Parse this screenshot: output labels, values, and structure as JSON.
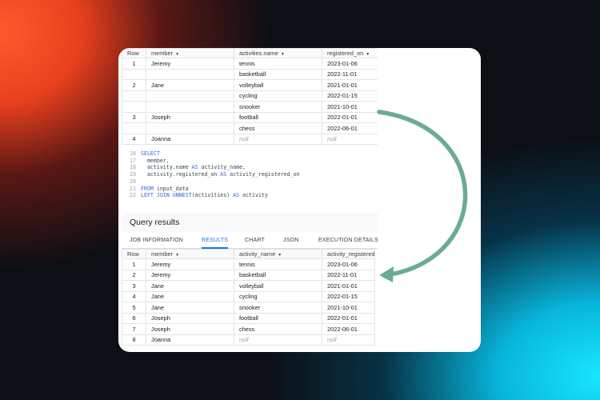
{
  "input_table": {
    "columns": [
      "Row",
      "member",
      "activities.name",
      "registered_on"
    ],
    "rows": [
      {
        "row": "1",
        "member": "Jeremy",
        "activities": [
          {
            "name": "tennis",
            "registered_on": "2023-01-06"
          },
          {
            "name": "basketball",
            "registered_on": "2022-11-01"
          }
        ]
      },
      {
        "row": "2",
        "member": "Jane",
        "activities": [
          {
            "name": "volleyball",
            "registered_on": "2021-01-01"
          },
          {
            "name": "cycling",
            "registered_on": "2022-01-15"
          },
          {
            "name": "snooker",
            "registered_on": "2021-10-01"
          }
        ]
      },
      {
        "row": "3",
        "member": "Joseph",
        "activities": [
          {
            "name": "football",
            "registered_on": "2022-01-01"
          },
          {
            "name": "chess",
            "registered_on": "2022-06-01"
          }
        ]
      },
      {
        "row": "4",
        "member": "Joanna",
        "activities": [
          {
            "name": "null",
            "registered_on": "null"
          }
        ]
      }
    ]
  },
  "sql": {
    "lines": [
      {
        "num": "16",
        "text": "SELECT"
      },
      {
        "num": "17",
        "text": "  member,"
      },
      {
        "num": "18",
        "text": "  activity.name AS activity_name,"
      },
      {
        "num": "19",
        "text": "  activity.registered_on AS activity_registered_on"
      },
      {
        "num": "20",
        "text": ""
      },
      {
        "num": "21",
        "text": "FROM input_data"
      },
      {
        "num": "22",
        "text": "LEFT JOIN UNNEST(activities) AS activity"
      }
    ]
  },
  "results": {
    "title": "Query results",
    "tabs": [
      "JOB INFORMATION",
      "RESULTS",
      "CHART",
      "JSON",
      "EXECUTION DETAILS"
    ],
    "active_tab": "RESULTS",
    "columns": [
      "Row",
      "member",
      "activity_name",
      "activity_registered_o"
    ],
    "rows": [
      [
        "1",
        "Jeremy",
        "tennis",
        "2023-01-06"
      ],
      [
        "2",
        "Jeremy",
        "basketball",
        "2022-11-01"
      ],
      [
        "3",
        "Jane",
        "volleyball",
        "2021-01-01"
      ],
      [
        "4",
        "Jane",
        "cycling",
        "2022-01-15"
      ],
      [
        "5",
        "Jane",
        "snooker",
        "2021-10-01"
      ],
      [
        "6",
        "Joseph",
        "football",
        "2022-01-01"
      ],
      [
        "7",
        "Joseph",
        "chess",
        "2022-06-01"
      ],
      [
        "8",
        "Joanna",
        "null",
        "null"
      ]
    ]
  },
  "colors": {
    "arrow": "#6aab97",
    "accent": "#1a73e8",
    "keyword": "#3367d6",
    "null_text": "#9aa0a6"
  },
  "icons": {
    "sort": "caret-down-icon"
  }
}
